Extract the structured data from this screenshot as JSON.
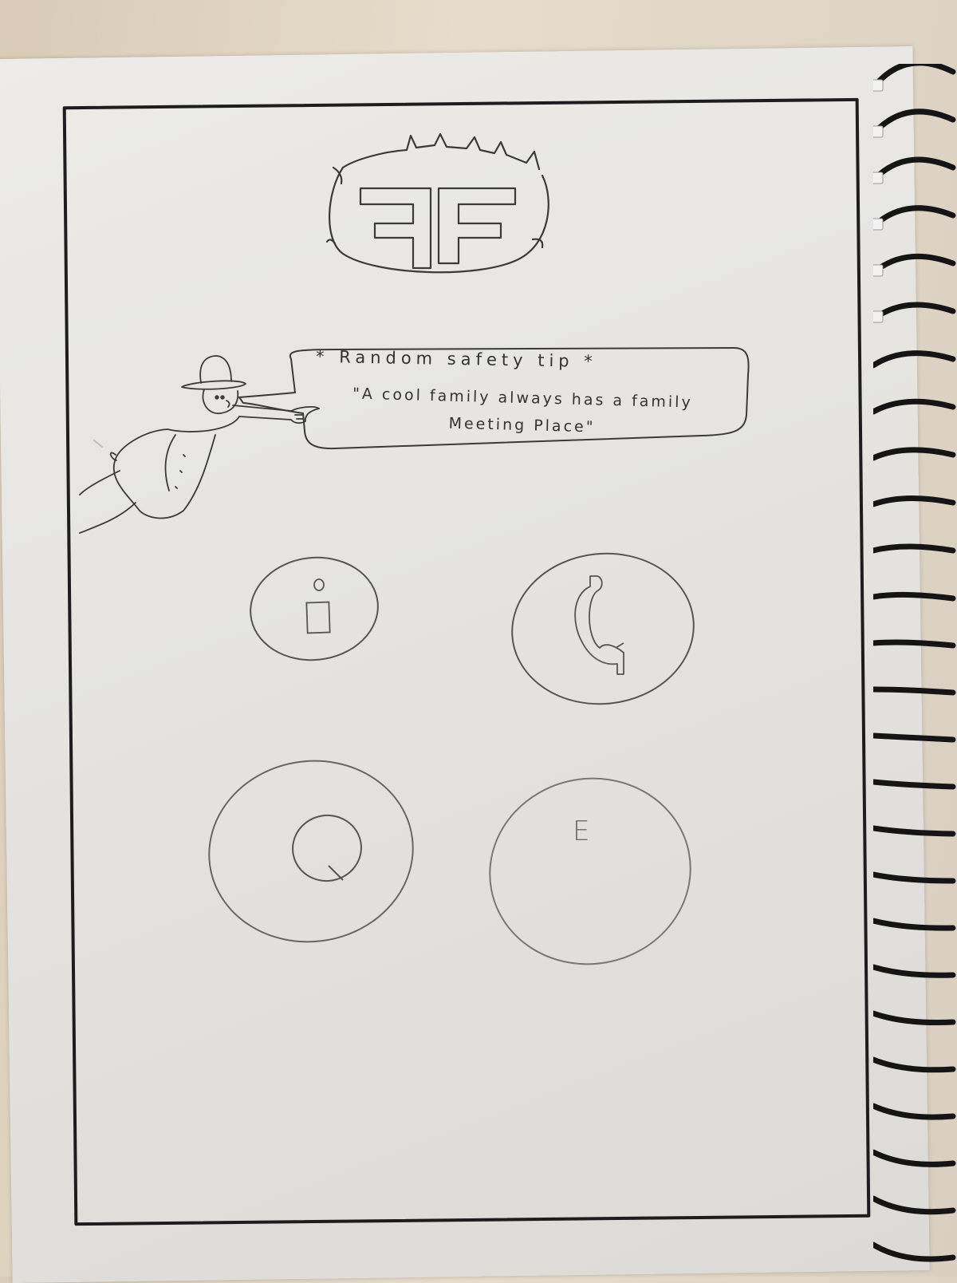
{
  "logo": {
    "letters": "FF",
    "icon": "flame-logo-icon"
  },
  "safety_tip": {
    "title": "* Random safety tip *",
    "text": "\"A cool family always has a family Meeting Place\""
  },
  "mascot": {
    "icon": "firefighter-mascot-icon"
  },
  "buttons": [
    {
      "icon": "info-icon"
    },
    {
      "icon": "phone-icon"
    },
    {
      "icon": "search-icon"
    },
    {
      "label": "E",
      "icon": "e-icon"
    }
  ],
  "colors": {
    "ink": "#333333",
    "pencil": "#6a6a6a",
    "frame": "#1d1d1f"
  }
}
